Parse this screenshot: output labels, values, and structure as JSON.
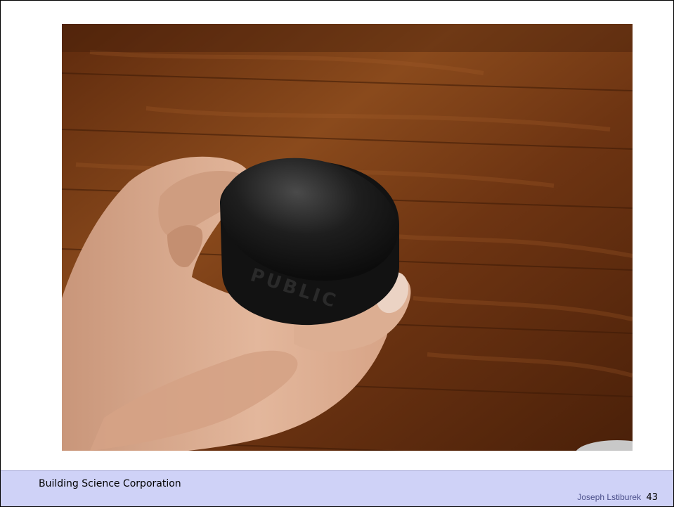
{
  "footer": {
    "organization": "Building Science Corporation",
    "author": "Joseph Lstiburek",
    "page_number": "43"
  },
  "photo": {
    "puck_lettering": "PUBLIC"
  },
  "colors": {
    "footer_background": "#cfd2f7",
    "wood_floor": "#7a3d16",
    "puck": "#141414",
    "skin": "#d9a98c"
  }
}
